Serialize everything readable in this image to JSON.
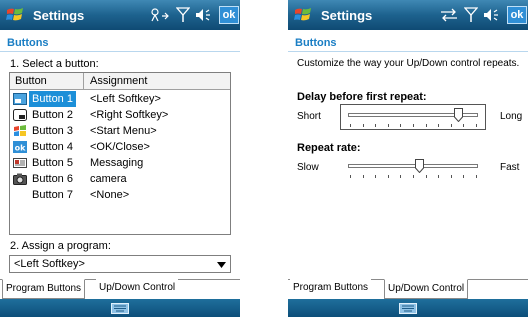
{
  "colors": {
    "titlebar": "#1d628e",
    "heading": "#1a7ec4",
    "selection": "#1c8fd8",
    "menubar": "#0c4e79",
    "ok_button": "#2f8fd6"
  },
  "left_screen": {
    "title": "Settings",
    "ok_label": "ok",
    "section_heading": "Buttons",
    "select_label": "1. Select a button:",
    "table": {
      "columns": [
        "Button",
        "Assignment"
      ],
      "rows": [
        {
          "button": "Button 1",
          "assignment": "<Left Softkey>",
          "icon": "left-softkey-icon",
          "selected": true
        },
        {
          "button": "Button 2",
          "assignment": "<Right Softkey>",
          "icon": "right-softkey-icon",
          "selected": false
        },
        {
          "button": "Button 3",
          "assignment": "<Start Menu>",
          "icon": "windows-flag-icon",
          "selected": false
        },
        {
          "button": "Button 4",
          "assignment": "<OK/Close>",
          "icon": "ok-icon",
          "selected": false
        },
        {
          "button": "Button 5",
          "assignment": "Messaging",
          "icon": "messaging-icon",
          "selected": false
        },
        {
          "button": "Button 6",
          "assignment": "camera",
          "icon": "camera-icon",
          "selected": false
        },
        {
          "button": "Button 7",
          "assignment": "<None>",
          "icon": "",
          "selected": false
        }
      ]
    },
    "assign_label": "2. Assign a program:",
    "program_value": "<Left Softkey>",
    "tabs": [
      {
        "label": "Program Buttons",
        "active": true
      },
      {
        "label": "Up/Down Control",
        "active": false
      }
    ]
  },
  "right_screen": {
    "title": "Settings",
    "ok_label": "ok",
    "section_heading": "Buttons",
    "description": "Customize the way your Up/Down control repeats.",
    "delay": {
      "heading": "Delay before first repeat:",
      "min_label": "Short",
      "max_label": "Long",
      "value": 0.85
    },
    "rate": {
      "heading": "Repeat rate:",
      "min_label": "Slow",
      "max_label": "Fast",
      "value": 0.55
    },
    "tabs": [
      {
        "label": "Program Buttons",
        "active": false
      },
      {
        "label": "Up/Down Control",
        "active": true
      }
    ]
  }
}
